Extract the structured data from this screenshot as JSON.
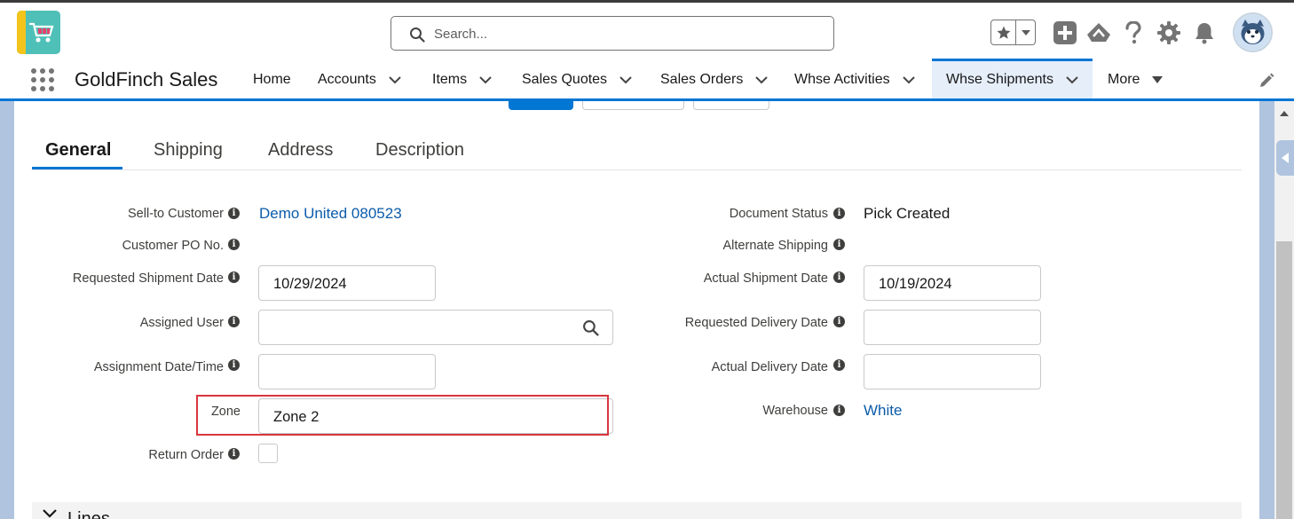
{
  "header": {
    "search_placeholder": "Search...",
    "icons": [
      "favorites-star-icon",
      "favorites-dropdown-icon",
      "global-add-icon",
      "trailhead-icon",
      "help-icon",
      "setup-gear-icon",
      "notifications-bell-icon",
      "user-avatar"
    ]
  },
  "nav": {
    "app_name": "GoldFinch Sales",
    "items": [
      {
        "label": "Home",
        "has_menu": false
      },
      {
        "label": "Accounts",
        "has_menu": true
      },
      {
        "label": "Items",
        "has_menu": true
      },
      {
        "label": "Sales Quotes",
        "has_menu": true
      },
      {
        "label": "Sales Orders",
        "has_menu": true
      },
      {
        "label": "Whse Activities",
        "has_menu": true
      },
      {
        "label": "Whse Shipments",
        "has_menu": true,
        "active": true
      },
      {
        "label": "More",
        "has_menu": true
      }
    ]
  },
  "tabs": [
    {
      "label": "General",
      "active": true
    },
    {
      "label": "Shipping"
    },
    {
      "label": "Address"
    },
    {
      "label": "Description"
    }
  ],
  "fields_left": {
    "sell_to_customer": {
      "label": "Sell-to Customer",
      "value": "Demo United 080523"
    },
    "customer_po": {
      "label": "Customer PO No.",
      "value": ""
    },
    "requested_shipment_date": {
      "label": "Requested Shipment Date",
      "value": "10/29/2024"
    },
    "assigned_user": {
      "label": "Assigned User",
      "value": ""
    },
    "assignment_datetime": {
      "label": "Assignment Date/Time",
      "value": ""
    },
    "zone": {
      "label": "Zone",
      "value": "Zone 2"
    },
    "return_order": {
      "label": "Return Order",
      "checked": false
    }
  },
  "fields_right": {
    "document_status": {
      "label": "Document Status",
      "value": "Pick Created"
    },
    "alternate_shipping": {
      "label": "Alternate Shipping",
      "value": ""
    },
    "actual_shipment_date": {
      "label": "Actual Shipment Date",
      "value": "10/19/2024"
    },
    "requested_delivery_date": {
      "label": "Requested Delivery Date",
      "value": ""
    },
    "actual_delivery_date": {
      "label": "Actual Delivery Date",
      "value": ""
    },
    "warehouse": {
      "label": "Warehouse",
      "value": "White"
    }
  },
  "sections": {
    "lines_label": "Lines"
  },
  "colors": {
    "brand": "#0176d3",
    "link": "#0b5cab",
    "highlight": "#d9363e",
    "page_background": "#b0c4df"
  }
}
